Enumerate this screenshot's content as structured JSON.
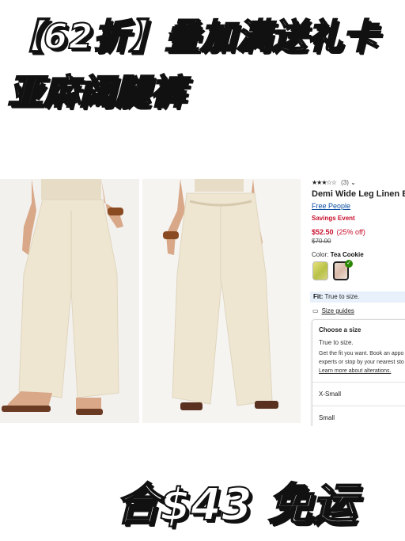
{
  "headline": {
    "line1": "【62折】叠加满送礼卡",
    "line2": "亚麻阔腿裤",
    "line3": "合$43 免运"
  },
  "product": {
    "rating_stars": "★★★☆☆",
    "rating_count": "(3)",
    "rating_chevron": "⌄",
    "title": "Demi Wide Leg Linen Ble",
    "brand": "Free People",
    "event": "Savings Event",
    "price": "$52.50",
    "discount": "(25% off)",
    "was_price": "$70.00",
    "color_label": "Color:",
    "color_value": "Tea Cookie",
    "fit_label": "Fit:",
    "fit_value": "True to size.",
    "size_guides": "Size guides",
    "size_card": {
      "heading": "Choose a size",
      "line1": "True to size.",
      "line2": "Get the fit you want. Book an appo",
      "line3": "experts or stop by your nearest sto",
      "link": "Learn more about alterations.",
      "size1": "X-Small",
      "size2": "Small"
    }
  },
  "colors": {
    "accent_red": "#c8102e",
    "link_blue": "#0b4da2",
    "fit_bg": "#e8f1fb",
    "check_green": "#2a8703",
    "pants_cream": "#efe6d2"
  },
  "icons": [
    "star-icon",
    "chevron-down-icon",
    "checkmark-icon",
    "ruler-icon"
  ]
}
